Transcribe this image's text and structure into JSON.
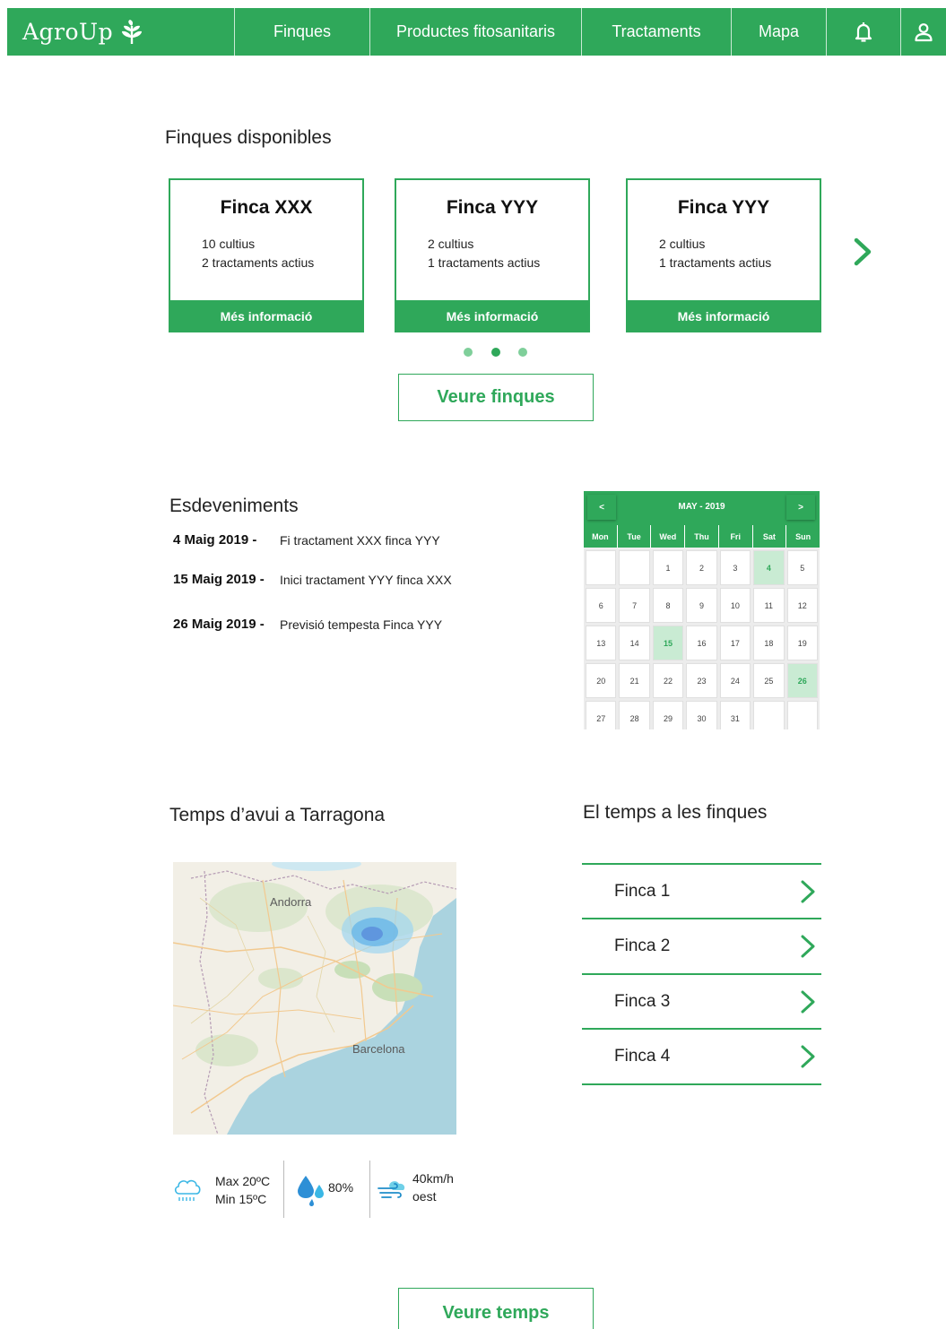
{
  "colors": {
    "accent": "#2fa85a",
    "accent_light": "#c9ebd3",
    "dot_light": "#7fcf9a"
  },
  "header": {
    "brand": "AgroUp",
    "nav": [
      {
        "label": "Finques"
      },
      {
        "label": "Productes fitosanitaris"
      },
      {
        "label": "Tractaments"
      },
      {
        "label": "Mapa"
      }
    ],
    "icons": [
      "bell-icon",
      "user-icon"
    ]
  },
  "farms": {
    "title": "Finques disponibles",
    "cards": [
      {
        "name": "Finca XXX",
        "crops": "10 cultius",
        "treatments": "2 tractaments actius",
        "button": "Més informació"
      },
      {
        "name": "Finca YYY",
        "crops": "2 cultius",
        "treatments": "1 tractaments actius",
        "button": "Més informació"
      },
      {
        "name": "Finca YYY",
        "crops": "2 cultius",
        "treatments": "1 tractaments actius",
        "button": "Més informació"
      }
    ],
    "carousel": {
      "pages": 3,
      "active_page": 2
    },
    "view_button": "Veure finques"
  },
  "events": {
    "title": "Esdeveniments",
    "items": [
      {
        "date": "4 Maig 2019 -",
        "text": "Fi tractament XXX finca YYY"
      },
      {
        "date": "15 Maig 2019 -",
        "text": "Inici tractament YYY finca XXX"
      },
      {
        "date": "26 Maig 2019 -",
        "text": "Previsió tempesta Finca YYY"
      }
    ]
  },
  "calendar": {
    "title": "MAY - 2019",
    "prev": "<",
    "next": ">",
    "weekdays": [
      "Mon",
      "Tue",
      "Wed",
      "Thu",
      "Fri",
      "Sat",
      "Sun"
    ],
    "days": [
      "",
      "",
      "1",
      "2",
      "3",
      "4",
      "5",
      "6",
      "7",
      "8",
      "9",
      "10",
      "11",
      "12",
      "13",
      "14",
      "15",
      "16",
      "17",
      "18",
      "19",
      "20",
      "21",
      "22",
      "23",
      "24",
      "25",
      "26",
      "27",
      "28",
      "29",
      "30",
      "31",
      "",
      ""
    ],
    "highlighted": [
      "4",
      "15",
      "26"
    ]
  },
  "weather": {
    "title": "Temps d’avui a Tarragona",
    "map_labels": {
      "andorra": "Andorra",
      "barcelona": "Barcelona"
    },
    "temp_max": "Max 20ºC",
    "temp_min": "Min 15ºC",
    "humidity": "80%",
    "wind_speed": "40km/h",
    "wind_dir": "oest",
    "view_button": "Veure temps"
  },
  "farm_weather": {
    "title": "El temps a les finques",
    "items": [
      {
        "label": "Finca 1"
      },
      {
        "label": "Finca 2"
      },
      {
        "label": "Finca 3"
      },
      {
        "label": "Finca 4"
      }
    ]
  }
}
